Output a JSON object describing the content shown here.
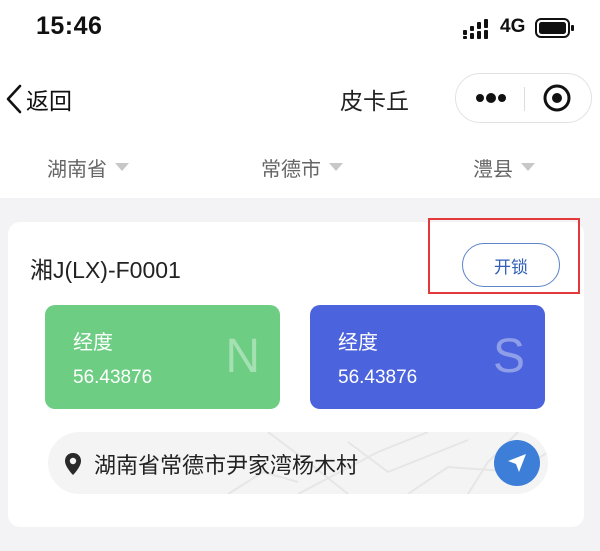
{
  "status_bar": {
    "time": "15:46",
    "network": "4G",
    "icons": [
      "signal-icon",
      "battery-icon"
    ]
  },
  "nav": {
    "back_label": "返回",
    "title": "皮卡丘",
    "icons": [
      "chevron-left-icon",
      "more-dots-icon",
      "close-target-icon"
    ]
  },
  "region": {
    "province": "湖南省",
    "city": "常德市",
    "county": "澧县"
  },
  "device": {
    "plate": "湘J(LX)-F0001",
    "unlock_label": "开锁"
  },
  "coordinates": [
    {
      "label": "经度",
      "value": "56.43876",
      "letter": "N",
      "color": "#6ccd83"
    },
    {
      "label": "经度",
      "value": "56.43876",
      "letter": "S",
      "color": "#4b63dc"
    }
  ],
  "location": {
    "address": "湖南省常德市尹家湾杨木村",
    "icons": [
      "location-pin-icon",
      "navigate-icon"
    ]
  },
  "colors": {
    "accent": "#2f5fb8",
    "highlight_outline": "#e23a3a",
    "locate_button": "#3d7fd8",
    "background": "#f3f3f5"
  }
}
